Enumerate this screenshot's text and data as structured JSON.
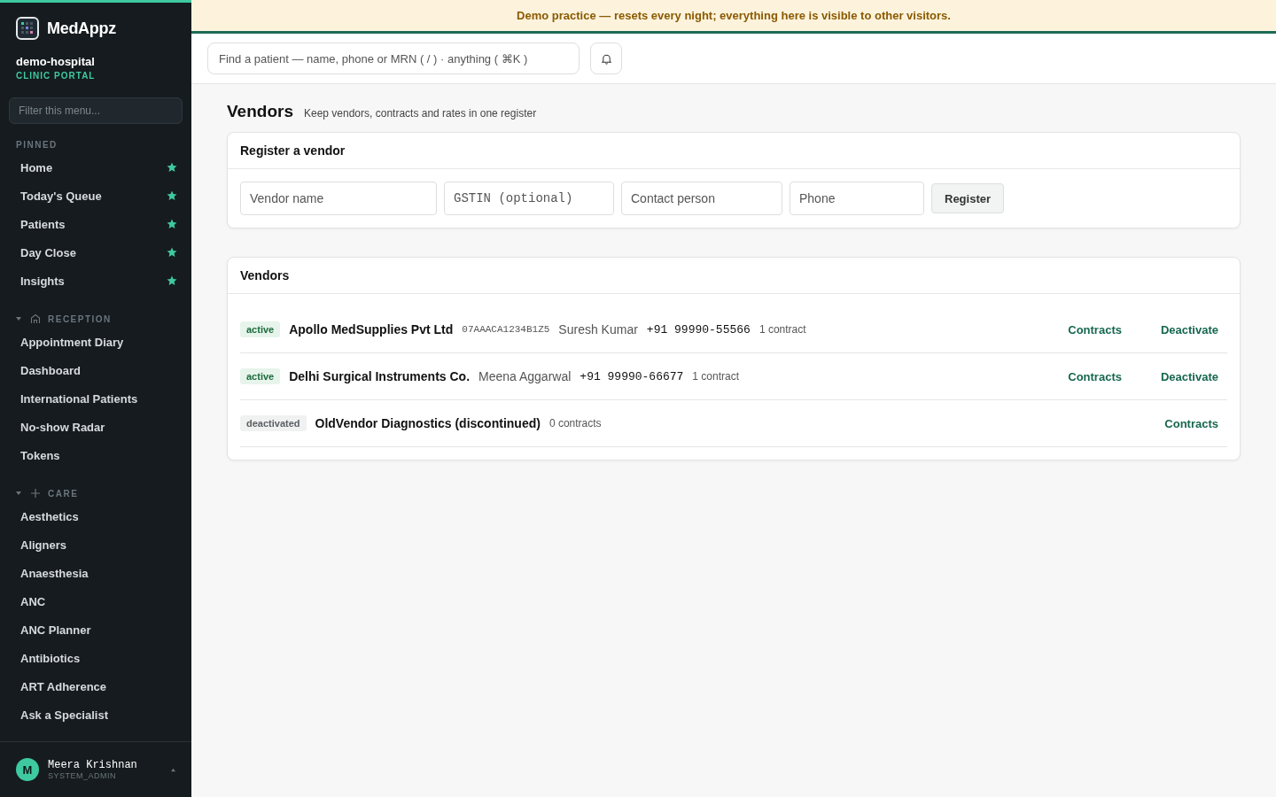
{
  "brand": {
    "name": "MedAppz",
    "org": "demo-hospital",
    "portal": "CLINIC PORTAL"
  },
  "sidebar": {
    "filter_placeholder": "Filter this menu...",
    "pinned": {
      "title": "PINNED",
      "items": [
        {
          "label": "Home",
          "starred": true
        },
        {
          "label": "Today's Queue",
          "starred": true
        },
        {
          "label": "Patients",
          "starred": true
        },
        {
          "label": "Day Close",
          "starred": true
        },
        {
          "label": "Insights",
          "starred": true
        }
      ]
    },
    "sections": [
      {
        "title": "RECEPTION",
        "expanded": true,
        "items": [
          "Appointment Diary",
          "Dashboard",
          "International Patients",
          "No-show Radar",
          "Tokens"
        ]
      },
      {
        "title": "CARE",
        "expanded": true,
        "items": [
          "Aesthetics",
          "Aligners",
          "Anaesthesia",
          "ANC",
          "ANC Planner",
          "Antibiotics",
          "ART Adherence",
          "Ask a Specialist"
        ]
      }
    ],
    "user": {
      "initial": "M",
      "name": "Meera Krishnan",
      "role": "SYSTEM_ADMIN"
    }
  },
  "banner": "Demo practice — resets every night; everything here is visible to other visitors.",
  "search": {
    "placeholder": "Find a patient — name, phone or MRN ( / ) · anything ( ⌘K )"
  },
  "page": {
    "title": "Vendors",
    "subtitle": "Keep vendors, contracts and rates in one register"
  },
  "register": {
    "title": "Register a vendor",
    "fields": [
      {
        "placeholder": "Vendor name",
        "kind": "text"
      },
      {
        "placeholder": "GSTIN (optional)",
        "kind": "code"
      },
      {
        "placeholder": "Contact person",
        "kind": "text"
      },
      {
        "placeholder": "Phone",
        "kind": "text"
      }
    ],
    "button": "Register"
  },
  "vendors": {
    "title": "Vendors",
    "rows": [
      {
        "status": "active",
        "active": true,
        "name": "Apollo MedSupplies Pvt Ltd",
        "gstin": "07AAACA1234B1Z5",
        "contact": "Suresh Kumar",
        "phone": "+91 99990-55566",
        "contracts": "1 contract",
        "actions": [
          "Contracts",
          "Deactivate"
        ]
      },
      {
        "status": "active",
        "active": true,
        "name": "Delhi Surgical Instruments Co.",
        "contact": "Meena Aggarwal",
        "phone": "+91 99990-66677",
        "contracts": "1 contract",
        "actions": [
          "Contracts",
          "Deactivate"
        ]
      },
      {
        "status": "deactivated",
        "active": false,
        "name": "OldVendor Diagnostics (discontinued)",
        "contracts": "0 contracts",
        "actions": [
          "Contracts"
        ]
      }
    ]
  }
}
